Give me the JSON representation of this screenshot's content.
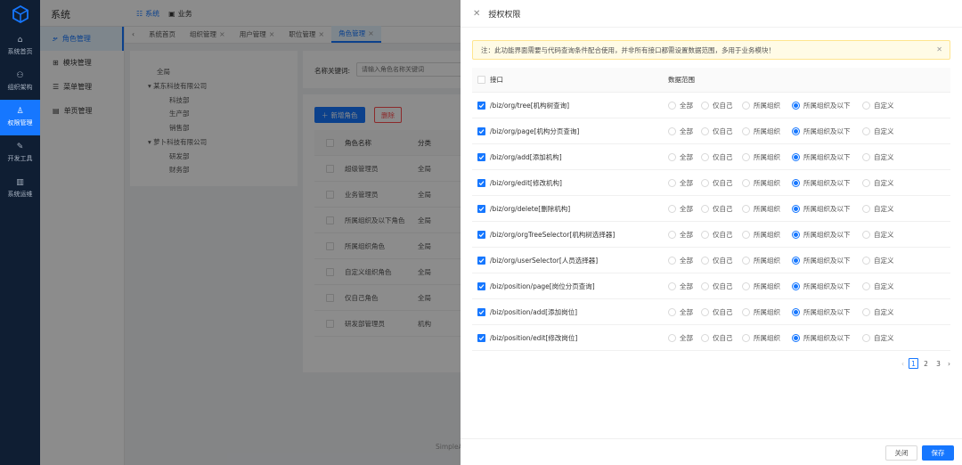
{
  "rail": {
    "items": [
      {
        "label": "系统首页",
        "icon": "home-icon"
      },
      {
        "label": "组织架构",
        "icon": "org-icon"
      },
      {
        "label": "权限管理",
        "icon": "user-lock-icon",
        "active": true
      },
      {
        "label": "开发工具",
        "icon": "wrench-icon"
      },
      {
        "label": "系统运维",
        "icon": "doc-icon"
      }
    ]
  },
  "header": {
    "app_name": "系统",
    "nav": [
      {
        "label": "系统",
        "selected": true
      },
      {
        "label": "业务",
        "selected": false
      }
    ]
  },
  "sidebar": {
    "items": [
      {
        "label": "角色管理",
        "active": true
      },
      {
        "label": "模块管理",
        "active": false
      },
      {
        "label": "菜单管理",
        "active": false
      },
      {
        "label": "单页管理",
        "active": false
      }
    ]
  },
  "tabs": [
    {
      "label": "系统首页",
      "closable": false,
      "selected": false
    },
    {
      "label": "组织管理",
      "closable": true,
      "selected": false
    },
    {
      "label": "用户管理",
      "closable": true,
      "selected": false
    },
    {
      "label": "职位管理",
      "closable": true,
      "selected": false
    },
    {
      "label": "角色管理",
      "closable": true,
      "selected": true
    }
  ],
  "org_tree": {
    "nodes": [
      {
        "label": "全局",
        "level": 0,
        "arrow": false
      },
      {
        "label": "某东科技有限公司",
        "level": 1,
        "arrow": true
      },
      {
        "label": "科技部",
        "level": 2,
        "arrow": false
      },
      {
        "label": "生产部",
        "level": 2,
        "arrow": false
      },
      {
        "label": "销售部",
        "level": 2,
        "arrow": false
      },
      {
        "label": "萝卜科技有限公司",
        "level": 1,
        "arrow": true
      },
      {
        "label": "研发部",
        "level": 2,
        "arrow": false
      },
      {
        "label": "财务部",
        "level": 2,
        "arrow": false
      }
    ]
  },
  "filter": {
    "label": "名称关键词:",
    "placeholder": "请输入角色名称关键词"
  },
  "role_panel": {
    "add_label": "新增角色",
    "delete_label": "删除",
    "columns": [
      "角色名称",
      "分类"
    ],
    "rows": [
      {
        "name": "超级管理员",
        "category": "全局"
      },
      {
        "name": "业务管理员",
        "category": "全局"
      },
      {
        "name": "所属组织及以下角色",
        "category": "全局"
      },
      {
        "name": "所属组织角色",
        "category": "全局"
      },
      {
        "name": "自定义组织角色",
        "category": "全局"
      },
      {
        "name": "仅自己角色",
        "category": "全局"
      },
      {
        "name": "研发部管理员",
        "category": "机构"
      }
    ]
  },
  "footer": {
    "text": "SimpleA"
  },
  "drawer": {
    "title": "授权权限",
    "notice": "注：此功能界面需要与代码查询条件配合使用，并非所有接口都需设置数据范围，多用于业务模块！",
    "columns": {
      "api": "接口",
      "scope": "数据范围"
    },
    "scope_options": [
      "全部",
      "仅自己",
      "所属组织",
      "所属组织及以下",
      "自定义"
    ],
    "rows": [
      {
        "api": "/biz/org/tree[机构树查询]",
        "checked": true,
        "scope": 3
      },
      {
        "api": "/biz/org/page[机构分页查询]",
        "checked": true,
        "scope": 3
      },
      {
        "api": "/biz/org/add[添加机构]",
        "checked": true,
        "scope": 3
      },
      {
        "api": "/biz/org/edit[修改机构]",
        "checked": true,
        "scope": 3
      },
      {
        "api": "/biz/org/delete[删除机构]",
        "checked": true,
        "scope": 3
      },
      {
        "api": "/biz/org/orgTreeSelector[机构树选择器]",
        "checked": true,
        "scope": 3
      },
      {
        "api": "/biz/org/userSelector[人员选择器]",
        "checked": true,
        "scope": 3
      },
      {
        "api": "/biz/position/page[岗位分页查询]",
        "checked": true,
        "scope": 3
      },
      {
        "api": "/biz/position/add[添加岗位]",
        "checked": true,
        "scope": 3
      },
      {
        "api": "/biz/position/edit[修改岗位]",
        "checked": true,
        "scope": 3
      }
    ],
    "pagination": {
      "pages": [
        "1",
        "2",
        "3"
      ],
      "current": "1"
    },
    "close_label": "关闭",
    "save_label": "保存"
  },
  "colors": {
    "primary": "#1677ff",
    "rail": "#0f1e33",
    "danger": "#ff4d4f",
    "notice_bg": "#fffbe6"
  }
}
